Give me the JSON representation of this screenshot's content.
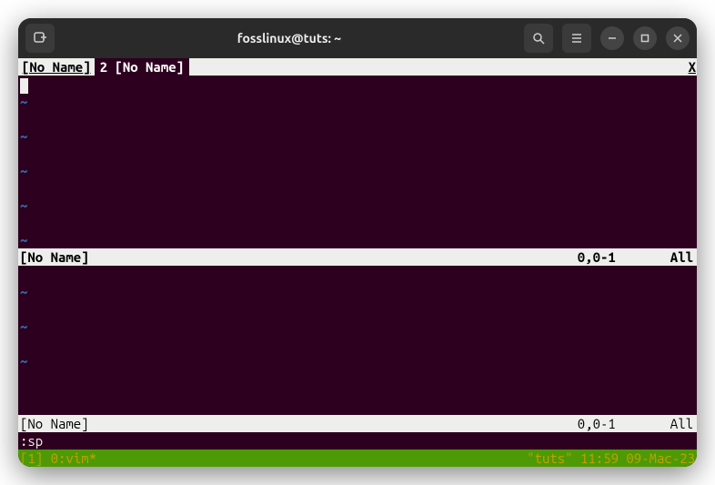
{
  "titlebar": {
    "title": "fosslinux@tuts: ~"
  },
  "vim": {
    "tabs": {
      "inactive_label": " [No Name] ",
      "active_prefix": " 2 ",
      "active_label": "[No Name] ",
      "close": "X"
    },
    "split1": {
      "status_name": "[No Name]",
      "status_pos": "0,0-1",
      "status_pct": "All"
    },
    "split2": {
      "status_name": "[No Name]",
      "status_pos": "0,0-1",
      "status_pct": "All"
    },
    "tilde": "~",
    "cmdline": ":sp"
  },
  "tmux": {
    "left": "[1] 0:vim*",
    "right_session": "\"tuts\"",
    "right_time": " 11:59 09-Mac-23"
  }
}
